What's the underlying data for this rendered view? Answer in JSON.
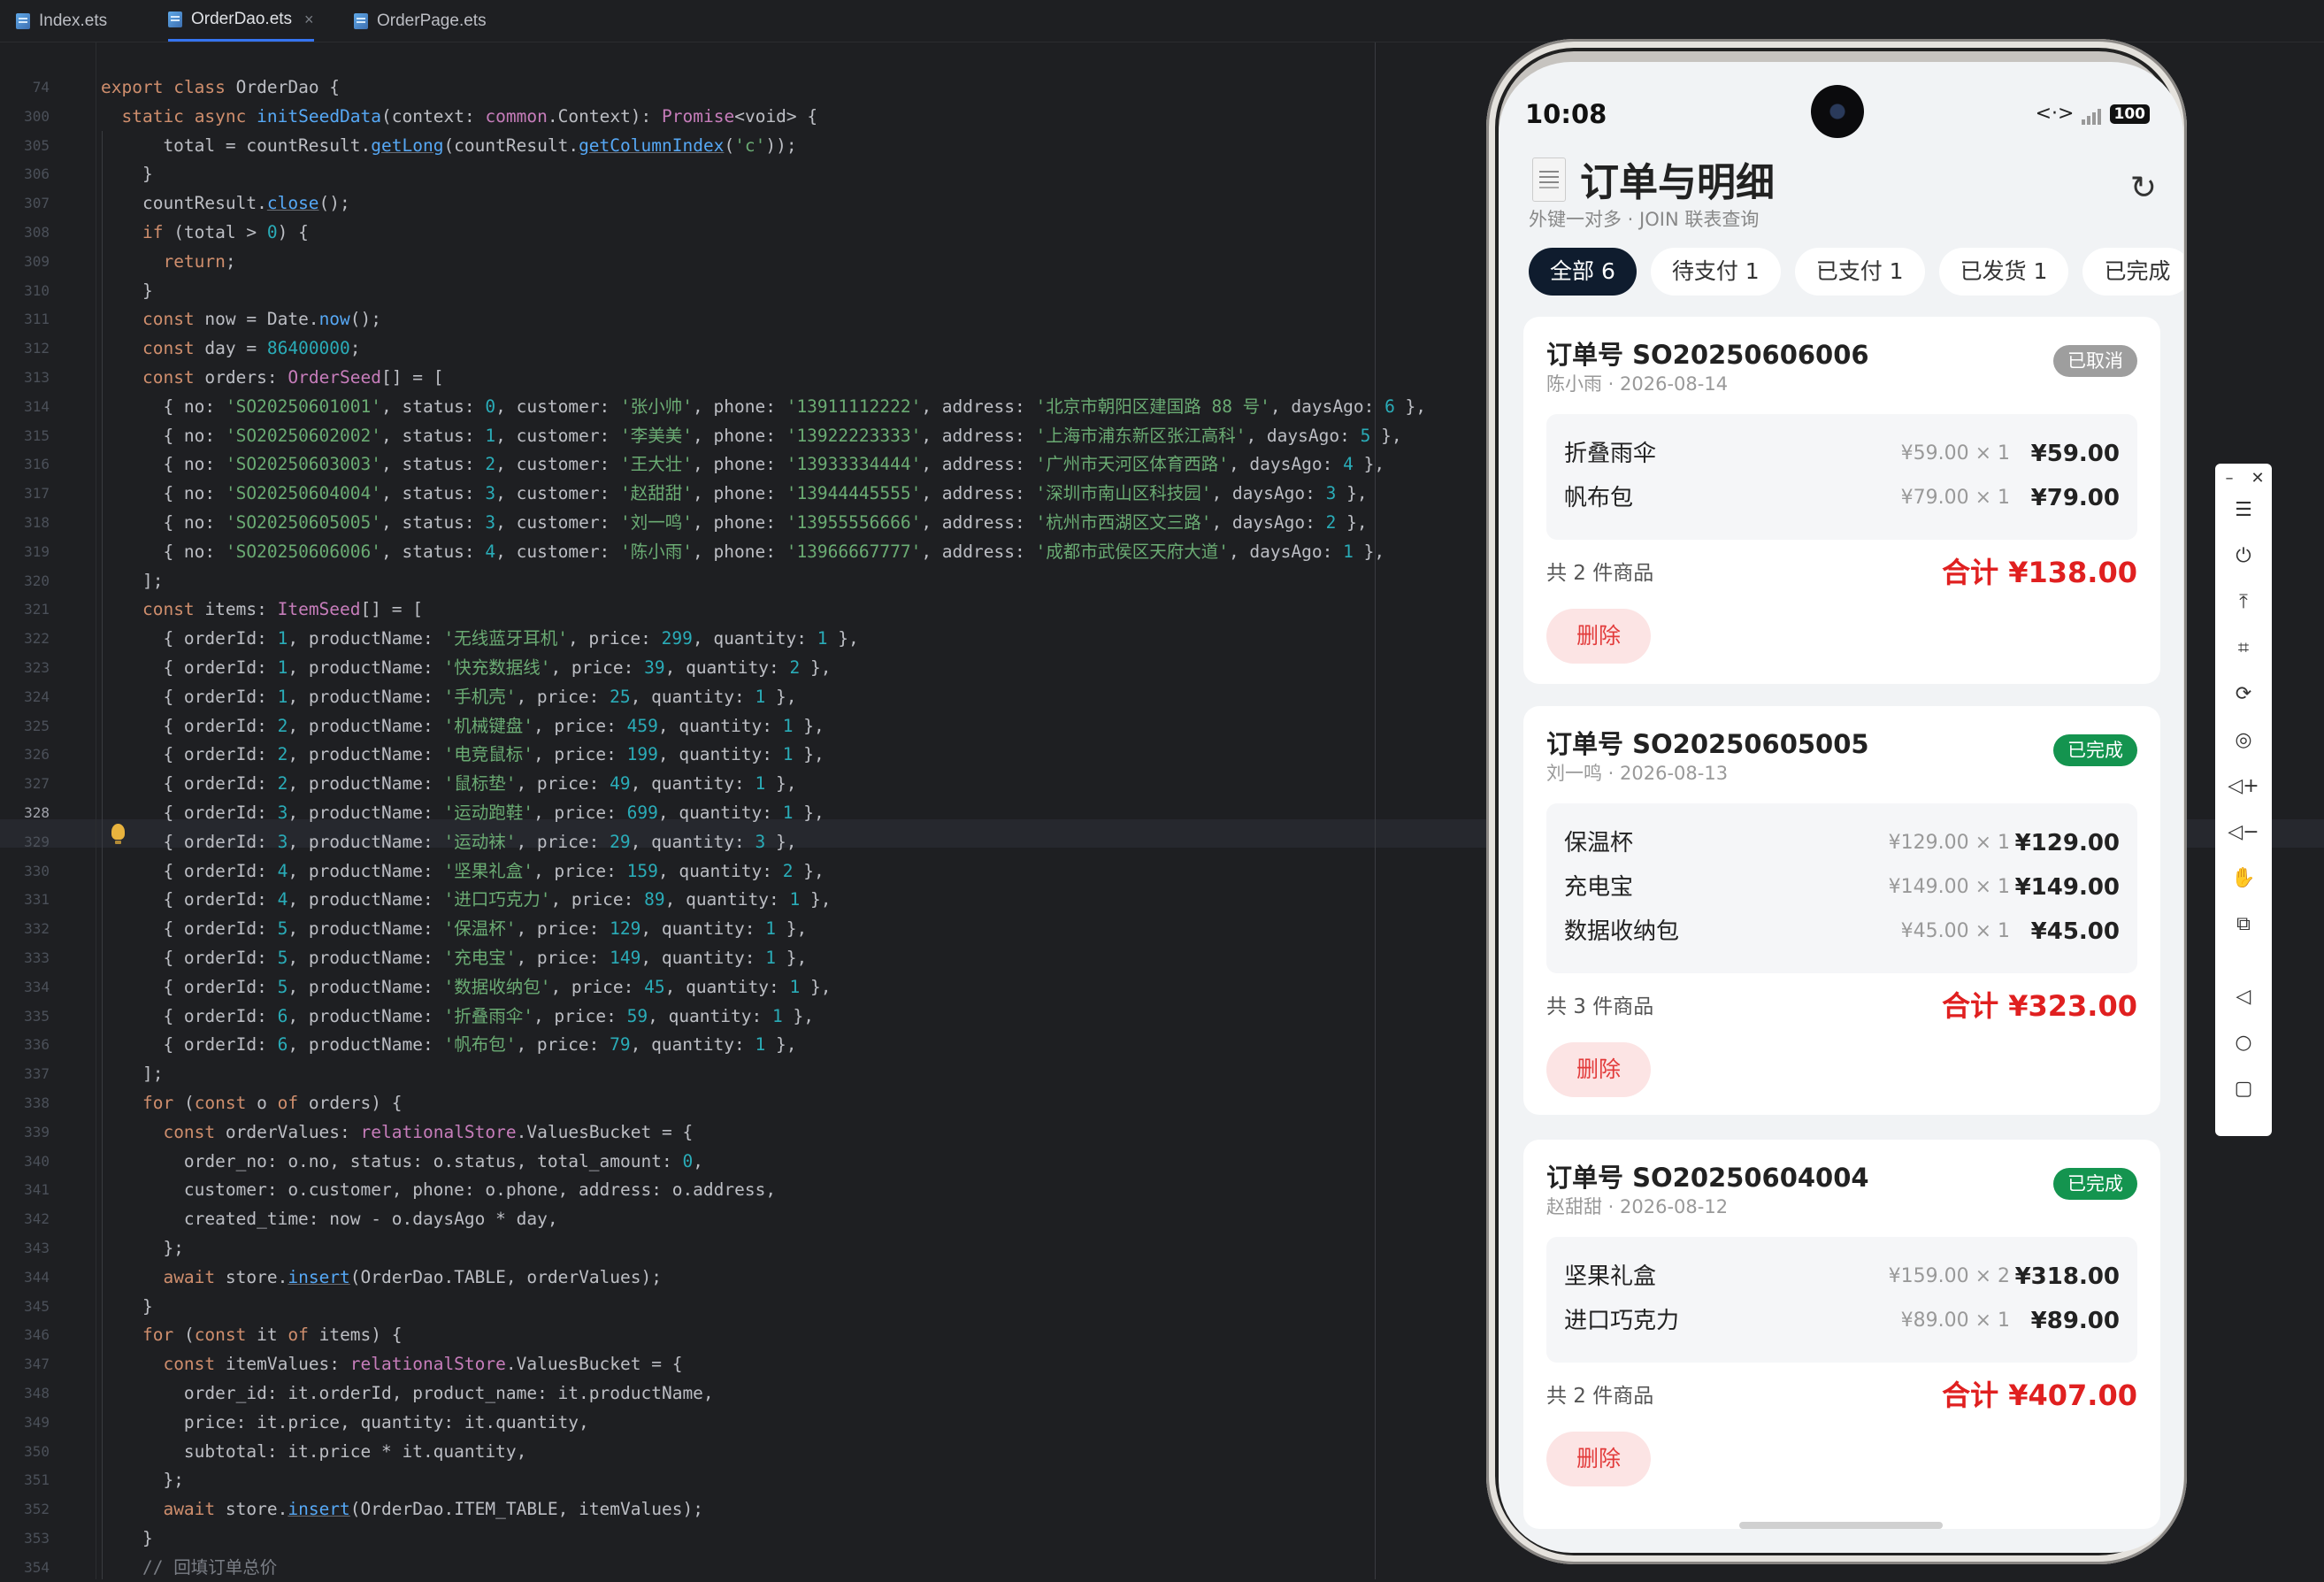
{
  "tabs": [
    {
      "label": "Index.ets",
      "active": false
    },
    {
      "label": "OrderDao.ets",
      "active": true
    },
    {
      "label": "OrderPage.ets",
      "active": false
    }
  ],
  "gutter": [
    "74",
    "300",
    "305",
    "306",
    "307",
    "308",
    "309",
    "310",
    "311",
    "312",
    "313",
    "314",
    "315",
    "316",
    "317",
    "318",
    "319",
    "320",
    "321",
    "322",
    "323",
    "324",
    "325",
    "326",
    "327",
    "328",
    "329",
    "330",
    "331",
    "332",
    "333",
    "334",
    "335",
    "336",
    "337",
    "338",
    "339",
    "340",
    "341",
    "342",
    "343",
    "344",
    "345",
    "346",
    "347",
    "348",
    "349",
    "350",
    "351",
    "352",
    "353",
    "354"
  ],
  "current_line": "328",
  "code": [
    "export class OrderDao {",
    "  static async initSeedData(context: common.Context): Promise<void> {",
    "      total = countResult.getLong(countResult.getColumnIndex('c'));",
    "    }",
    "    countResult.close();",
    "    if (total > 0) {",
    "      return;",
    "    }",
    "    const now = Date.now();",
    "    const day = 86400000;",
    "    const orders: OrderSeed[] = [",
    "      { no: 'SO20250601001', status: 0, customer: '张小帅', phone: '13911112222', address: '北京市朝阳区建国路 88 号', daysAgo: 6 },",
    "      { no: 'SO20250602002', status: 1, customer: '李美美', phone: '13922223333', address: '上海市浦东新区张江高科', daysAgo: 5 },",
    "      { no: 'SO20250603003', status: 2, customer: '王大壮', phone: '13933334444', address: '广州市天河区体育西路', daysAgo: 4 },",
    "      { no: 'SO20250604004', status: 3, customer: '赵甜甜', phone: '13944445555', address: '深圳市南山区科技园', daysAgo: 3 },",
    "      { no: 'SO20250605005', status: 3, customer: '刘一鸣', phone: '13955556666', address: '杭州市西湖区文三路', daysAgo: 2 },",
    "      { no: 'SO20250606006', status: 4, customer: '陈小雨', phone: '13966667777', address: '成都市武侯区天府大道', daysAgo: 1 },",
    "    ];",
    "    const items: ItemSeed[] = [",
    "      { orderId: 1, productName: '无线蓝牙耳机', price: 299, quantity: 1 },",
    "      { orderId: 1, productName: '快充数据线', price: 39, quantity: 2 },",
    "      { orderId: 1, productName: '手机壳', price: 25, quantity: 1 },",
    "      { orderId: 2, productName: '机械键盘', price: 459, quantity: 1 },",
    "      { orderId: 2, productName: '电竞鼠标', price: 199, quantity: 1 },",
    "      { orderId: 2, productName: '鼠标垫', price: 49, quantity: 1 },",
    "      { orderId: 3, productName: '运动跑鞋', price: 699, quantity: 1 },",
    "      { orderId: 3, productName: '运动袜', price: 29, quantity: 3 },",
    "      { orderId: 4, productName: '坚果礼盒', price: 159, quantity: 2 },",
    "      { orderId: 4, productName: '进口巧克力', price: 89, quantity: 1 },",
    "      { orderId: 5, productName: '保温杯', price: 129, quantity: 1 },",
    "      { orderId: 5, productName: '充电宝', price: 149, quantity: 1 },",
    "      { orderId: 5, productName: '数据收纳包', price: 45, quantity: 1 },",
    "      { orderId: 6, productName: '折叠雨伞', price: 59, quantity: 1 },",
    "      { orderId: 6, productName: '帆布包', price: 79, quantity: 1 },",
    "    ];",
    "    for (const o of orders) {",
    "      const orderValues: relationalStore.ValuesBucket = {",
    "        order_no: o.no, status: o.status, total_amount: 0,",
    "        customer: o.customer, phone: o.phone, address: o.address,",
    "        created_time: now - o.daysAgo * day,",
    "      };",
    "      await store.insert(OrderDao.TABLE, orderValues);",
    "    }",
    "    for (const it of items) {",
    "      const itemValues: relationalStore.ValuesBucket = {",
    "        order_id: it.orderId, product_name: it.productName,",
    "        price: it.price, quantity: it.quantity,",
    "        subtotal: it.price * it.quantity,",
    "      };",
    "      await store.insert(OrderDao.ITEM_TABLE, itemValues);",
    "    }",
    "    // 回填订单总价"
  ],
  "phone": {
    "time": "10:08",
    "battery": "100",
    "title": "订单与明细",
    "subtitle": "外键一对多 · JOIN 联表查询",
    "filter_tabs": [
      "全部 6",
      "待支付 1",
      "已支付 1",
      "已发货 1",
      "已完成"
    ],
    "orders": [
      {
        "title": "订单号 SO20250606006",
        "meta": "陈小雨 · 2026-08-14",
        "status": "已取消",
        "status_kind": "cancel",
        "items": [
          {
            "name": "折叠雨伞",
            "unit": "¥59.00 × 1",
            "subtotal": "¥59.00"
          },
          {
            "name": "帆布包",
            "unit": "¥79.00 × 1",
            "subtotal": "¥79.00"
          }
        ],
        "count": "共 2 件商品",
        "total": "合计 ¥138.00",
        "delete": "删除"
      },
      {
        "title": "订单号 SO20250605005",
        "meta": "刘一鸣 · 2026-08-13",
        "status": "已完成",
        "status_kind": "done",
        "items": [
          {
            "name": "保温杯",
            "unit": "¥129.00 × 1",
            "subtotal": "¥129.00"
          },
          {
            "name": "充电宝",
            "unit": "¥149.00 × 1",
            "subtotal": "¥149.00"
          },
          {
            "name": "数据收纳包",
            "unit": "¥45.00 × 1",
            "subtotal": "¥45.00"
          }
        ],
        "count": "共 3 件商品",
        "total": "合计 ¥323.00",
        "delete": "删除"
      },
      {
        "title": "订单号 SO20250604004",
        "meta": "赵甜甜 · 2026-08-12",
        "status": "已完成",
        "status_kind": "done",
        "items": [
          {
            "name": "坚果礼盒",
            "unit": "¥159.00 × 2",
            "subtotal": "¥318.00"
          },
          {
            "name": "进口巧克力",
            "unit": "¥89.00 × 1",
            "subtotal": "¥89.00"
          }
        ],
        "count": "共 2 件商品",
        "total": "合计 ¥407.00",
        "delete": "删除"
      }
    ]
  },
  "emulator_toolbar": [
    "minimize-icon",
    "close-icon",
    "menu-icon",
    "power-icon",
    "pin-top-icon",
    "crop-icon",
    "rotate-icon",
    "location-icon",
    "volume-up-icon",
    "volume-down-icon",
    "shake-icon",
    "screenshot-icon",
    "back-icon",
    "home-icon",
    "recents-icon"
  ]
}
